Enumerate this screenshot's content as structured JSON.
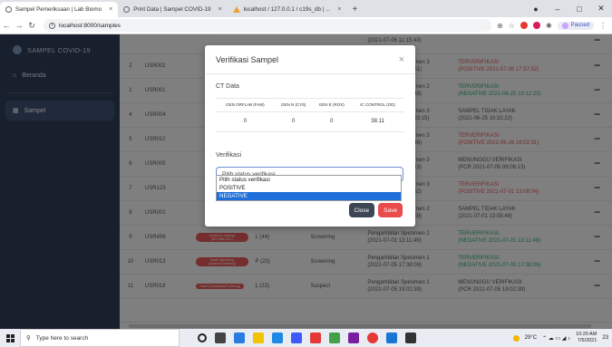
{
  "browser": {
    "tabs": [
      {
        "label": "Sampel Pemeriksaan | Lab Biomo",
        "active": true,
        "icon": "globe-icon"
      },
      {
        "label": "Print Data | Sampel COVID-19",
        "active": false,
        "icon": "globe-icon"
      },
      {
        "label": "localhost / 127.0.0.1 / c19s_db | ...",
        "active": false,
        "icon": "warning-icon"
      }
    ],
    "url": "localhost:8000/samples",
    "profile_label": "Paused"
  },
  "sidebar": {
    "brand": "SAMPEL COVID-19",
    "items": [
      {
        "label": "Beranda",
        "icon": "home-icon"
      },
      {
        "label": "Sampel",
        "icon": "table-icon",
        "active": true
      }
    ]
  },
  "table": {
    "rows": [
      {
        "no": "",
        "id": "",
        "badge": "",
        "ct": "",
        "purpose": "",
        "status_line1": "",
        "status_line2": "(2021-07-06 11:15:43)",
        "verif_line1": "",
        "verif_line2": "",
        "status_class": "",
        "verif_class": "green"
      },
      {
        "no": "2",
        "id": "USR002",
        "badge": "",
        "ct": "",
        "purpose": "",
        "status_line1": "Pengambilan Spesimen 3",
        "status_line2": "(2021-07-03 17:57:51)",
        "verif_line1": "TERVERIFIKASI",
        "verif_line2": "(POSITIVE 2021-07-06 17:57:52)",
        "verif_class": "red"
      },
      {
        "no": "1",
        "id": "USR001",
        "badge": "",
        "ct": "",
        "purpose": "",
        "status_line1": "Pengambilan Spesimen 2",
        "status_line2": "(2021-06-07 09:06:48)",
        "verif_line1": "TERVERIFIKASI",
        "verif_line2": "(NEGATIVE 2021-06-25 10:12:23)",
        "verif_class": "green"
      },
      {
        "no": "4",
        "id": "USR004",
        "badge": "",
        "ct": "",
        "purpose": "",
        "status_line1": "Pengambilan Spesimen 3",
        "status_line2": "(2021-06-16 07:03:33:15)",
        "verif_line1": "SAMPEL TIDAK LAYAK",
        "verif_line2": "(2021-06-25 10:32:22)",
        "verif_class": ""
      },
      {
        "no": "5",
        "id": "USR012",
        "badge": "",
        "ct": "",
        "purpose": "",
        "status_line1": "Pengambilan Spesimen 3",
        "status_line2": "(2021-06-07 12:12:46)",
        "verif_line1": "TERVERIFIKASI",
        "verif_line2": "(POSITIVE 2021-06-26 16:02:31)",
        "verif_class": "red"
      },
      {
        "no": "6",
        "id": "USR005",
        "badge": "",
        "ct": "",
        "purpose": "",
        "status_line1": "Pengambilan Spesimen 3",
        "status_line2": "(2021-07-05 08:06:13)",
        "verif_line1": "MENUNGGU VERIFIKASI",
        "verif_line2": "(PCR 2021-07-05 08:06:13)",
        "verif_class": ""
      },
      {
        "no": "7",
        "id": "USR123",
        "badge": "",
        "ct": "",
        "purpose": "",
        "status_line1": "Pengambilan Spesimen 3",
        "status_line2": "(2021-07-01 13:09:52)",
        "verif_line1": "TERVERIFIKASI",
        "verif_line2": "(POSITIVE 2021-07-01 13:08:04)",
        "verif_class": "red"
      },
      {
        "no": "8",
        "id": "USR001",
        "badge": "",
        "ct": "",
        "purpose": "",
        "status_line1": "Pengambilan Spesimen 2",
        "status_line2": "(2021-07-01 13:08:59)",
        "verif_line1": "SAMPEL TIDAK LAYAK",
        "verif_line2": "(2021-07-01 13:08:48)",
        "verif_class": ""
      },
      {
        "no": "9",
        "id": "USR456",
        "badge": "Spesimen Lainnya (SPL/BAL/DLL)",
        "ct": "L (44)",
        "purpose": "Screening",
        "status_line1": "Pengambilan Spesimen 2",
        "status_line2": "(2021-07-01 13:11:49)",
        "verif_line1": "TERVERIFIKASI",
        "verif_line2": "(NEGATIVE 2021-07-01 13:11:49)",
        "verif_class": "green"
      },
      {
        "no": "10",
        "id": "USR013",
        "badge": "Swab Nasofaring (Sputum/Orofaring)",
        "ct": "P (23)",
        "purpose": "Screening",
        "status_line1": "Pengambilan Spesimen 1",
        "status_line2": "(2021-07-05 17:38:09)",
        "verif_line1": "TERVERIFIKASI",
        "verif_line2": "(NEGATIVE 2021-07-05 17:38:09)",
        "verif_class": "green"
      },
      {
        "no": "11",
        "id": "USR018",
        "badge": "Swab (Nasofaring/Orofaring)",
        "ct": "L (23)",
        "purpose": "Suspect",
        "status_line1": "Pengambilan Spesimen 1",
        "status_line2": "(2021-07-05 19:02:39)",
        "verif_line1": "MENUNGGU VERIFIKASI",
        "verif_line2": "(PCR 2021-07-05 19:02:39)",
        "verif_class": ""
      }
    ],
    "action_label": "•••"
  },
  "modal": {
    "title": "Verifikasi Sampel",
    "close_glyph": "×",
    "ct_section_label": "CT Data",
    "ct_headers": [
      "GEN ORFLAB (FAM)",
      "GEN N (CY5)",
      "GEN E (ROX)",
      "IC CONTROL (OD)"
    ],
    "ct_values": [
      "0",
      "0",
      "0",
      "38.11"
    ],
    "verifikasi_label": "Verifikasi",
    "select_value": "Pilih status verifikasi",
    "options": [
      "Pilih status verifikasi",
      "POSITIVE",
      "NEGATIVE"
    ],
    "highlighted_option": "NEGATIVE",
    "close_button": "Close",
    "save_button": "Save"
  },
  "taskbar": {
    "search_placeholder": "Type here to search",
    "temperature": "29°C",
    "time": "10:20 AM",
    "date": "7/5/2021",
    "notification_count": "23"
  }
}
